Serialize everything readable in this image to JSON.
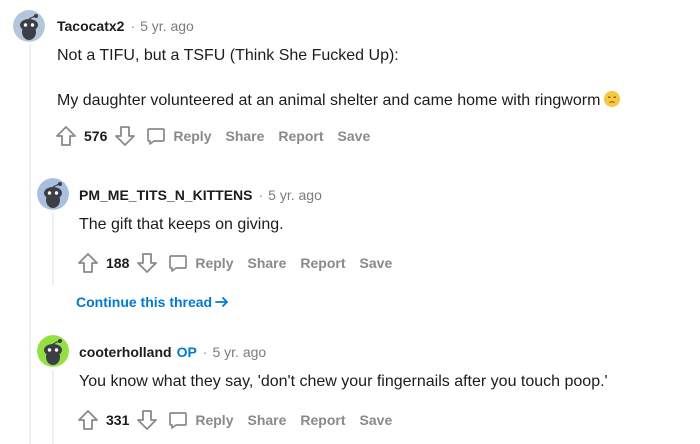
{
  "comments": [
    {
      "username": "Tacocatx2",
      "age": "5 yr. ago",
      "avatar_color": "#b4c6dc",
      "lines": [
        "Not a TIFU, but a TSFU (Think She Fucked Up):",
        "My daughter volunteered at an animal shelter and came home with ringworm"
      ],
      "emoji": "unamused-face-emoji",
      "score": "576"
    },
    {
      "username": "PM_ME_TITS_N_KITTENS",
      "age": "5 yr. ago",
      "avatar_color": "#a9bfe0",
      "lines": [
        "The gift that keeps on giving."
      ],
      "score": "188"
    },
    {
      "username": "cooterholland",
      "op_badge": "OP",
      "age": "5 yr. ago",
      "avatar_color": "#94e044",
      "lines": [
        "You know what they say, 'don't chew your fingernails after you touch poop.'"
      ],
      "score": "331"
    }
  ],
  "actions": {
    "reply": "Reply",
    "share": "Share",
    "report": "Report",
    "save": "Save"
  },
  "continue_thread": "Continue this thread",
  "separator": "·",
  "colors": {
    "accent": "#0079d3",
    "muted": "#878a8c",
    "thread_line": "#edeff1"
  }
}
